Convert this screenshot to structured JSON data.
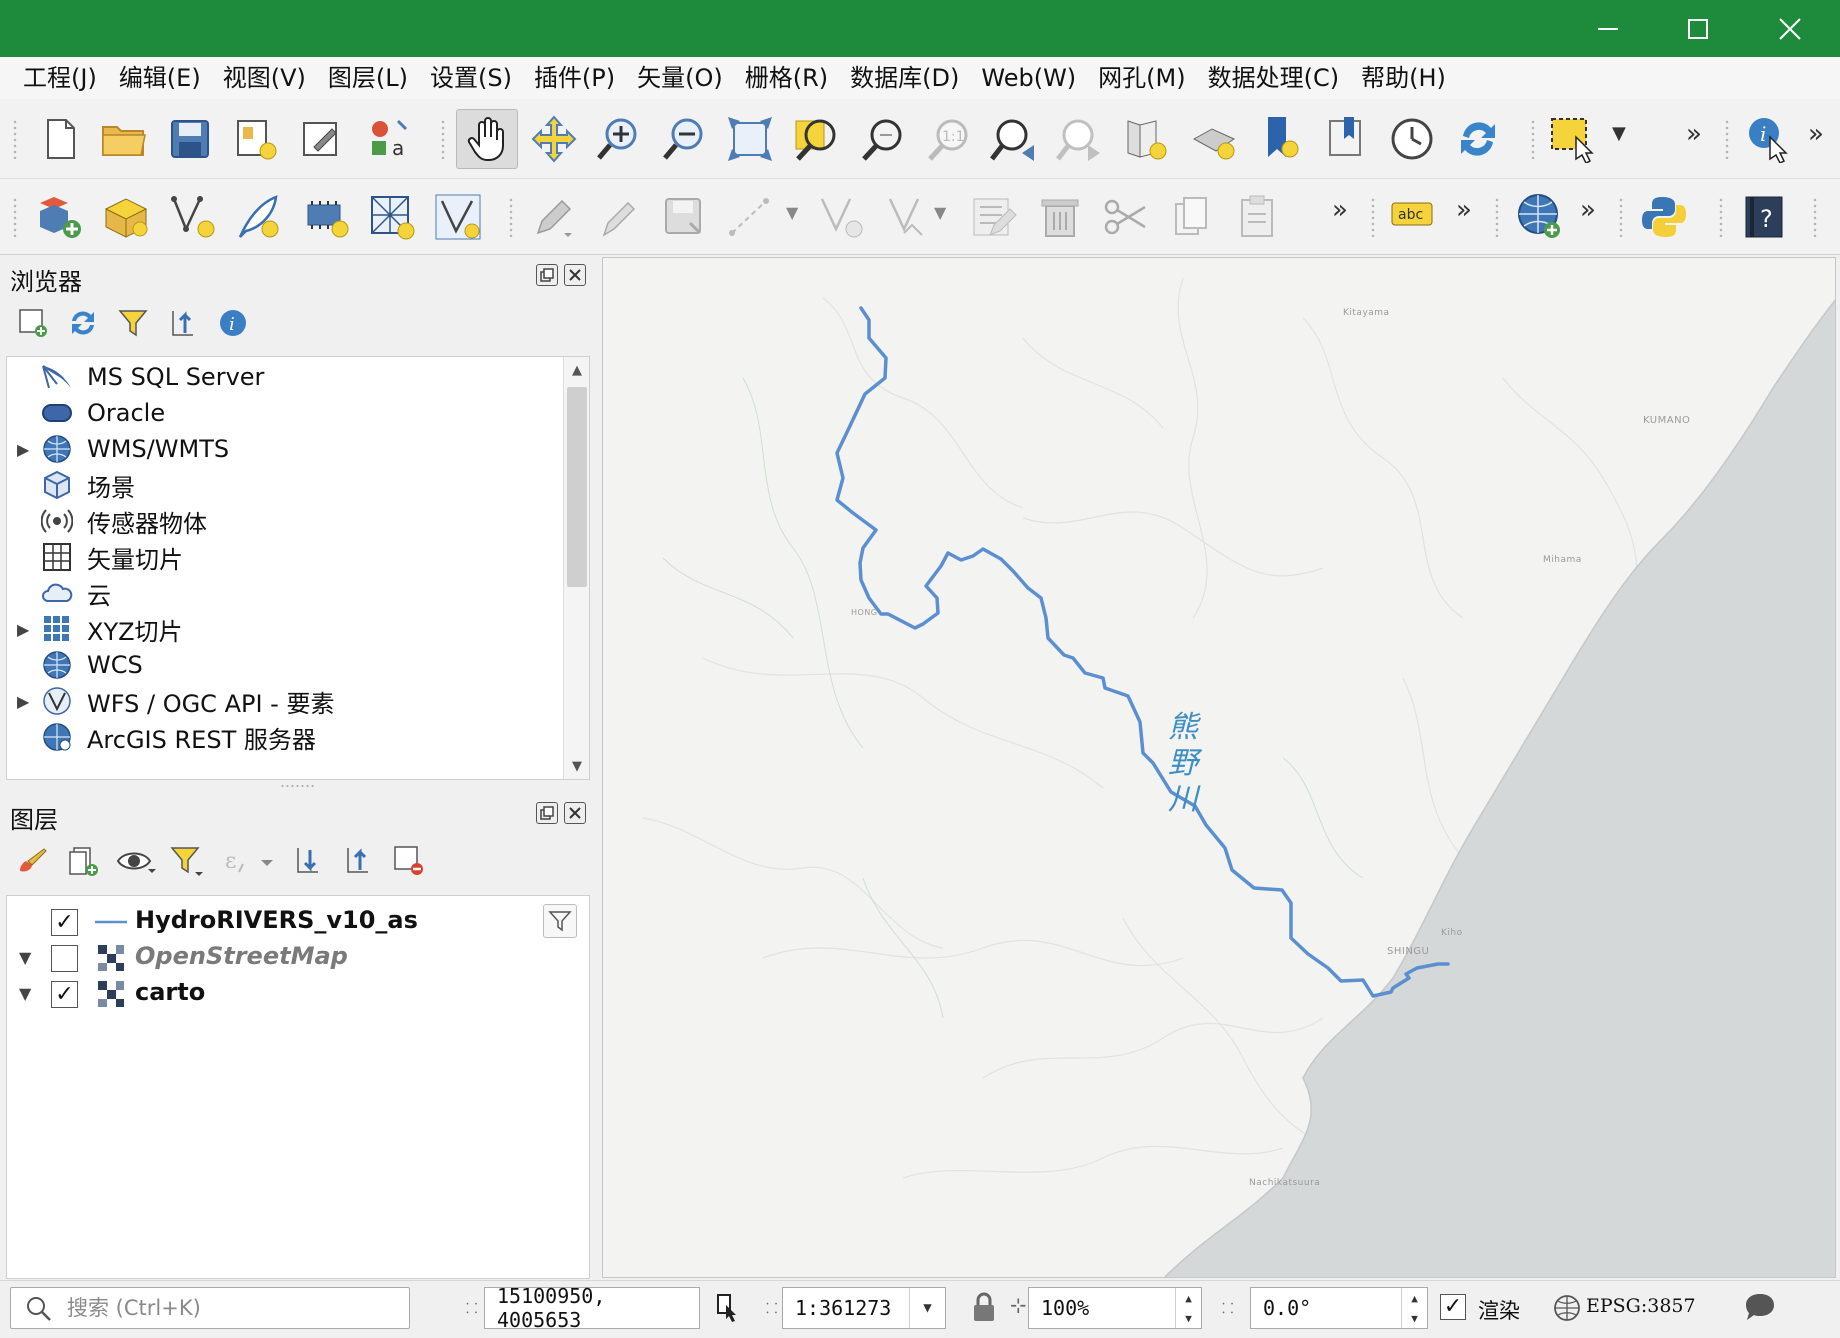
{
  "menu": [
    "工程(J)",
    "编辑(E)",
    "视图(V)",
    "图层(L)",
    "设置(S)",
    "插件(P)",
    "矢量(O)",
    "栅格(R)",
    "数据库(D)",
    "Web(W)",
    "网孔(M)",
    "数据处理(C)",
    "帮助(H)"
  ],
  "toolbar2": {
    "label_tool": "abc"
  },
  "browser": {
    "title": "浏览器",
    "items": [
      {
        "label": "MS SQL Server",
        "icon": "mssql-icon",
        "expandable": false
      },
      {
        "label": "Oracle",
        "icon": "oracle-icon",
        "expandable": false
      },
      {
        "label": "WMS/WMTS",
        "icon": "wms-globe-icon",
        "expandable": true
      },
      {
        "label": "场景",
        "icon": "scene-cube-icon",
        "expandable": false
      },
      {
        "label": "传感器物体",
        "icon": "sensor-icon",
        "expandable": false
      },
      {
        "label": "矢量切片",
        "icon": "vector-tile-icon",
        "expandable": false
      },
      {
        "label": "云",
        "icon": "cloud-icon",
        "expandable": false
      },
      {
        "label": "XYZ切片",
        "icon": "xyz-tile-icon",
        "expandable": true
      },
      {
        "label": "WCS",
        "icon": "wcs-globe-icon",
        "expandable": false
      },
      {
        "label": "WFS / OGC API - 要素",
        "icon": "wfs-icon",
        "expandable": true
      },
      {
        "label": "ArcGIS REST 服务器",
        "icon": "arcgis-rest-icon",
        "expandable": false
      }
    ]
  },
  "layers": {
    "title": "图层",
    "items": [
      {
        "name": "HydroRIVERS_v10_as",
        "checked": true,
        "type": "line",
        "italic": false
      },
      {
        "name": "OpenStreetMap",
        "checked": false,
        "type": "raster",
        "italic": true
      },
      {
        "name": "carto",
        "checked": true,
        "type": "raster",
        "italic": false
      }
    ]
  },
  "map": {
    "river_label": "熊野川",
    "places": [
      "Kitayama",
      "KUMANO",
      "Mihama",
      "HONG",
      "Kiho",
      "SHINGU",
      "Nachikatsuura"
    ],
    "colors": {
      "river": "#5b8fcf",
      "sea": "#d5d8d9",
      "land": "#f3f3f1"
    }
  },
  "status": {
    "search_placeholder": "搜索 (Ctrl+K)",
    "coordinate": "15100950, 4005653",
    "scale": "1:361273",
    "magnifier": "100%",
    "rotation": "0.0°",
    "render_label": "渲染",
    "render_checked": true,
    "crs": "EPSG:3857"
  },
  "check_mark": "✓"
}
